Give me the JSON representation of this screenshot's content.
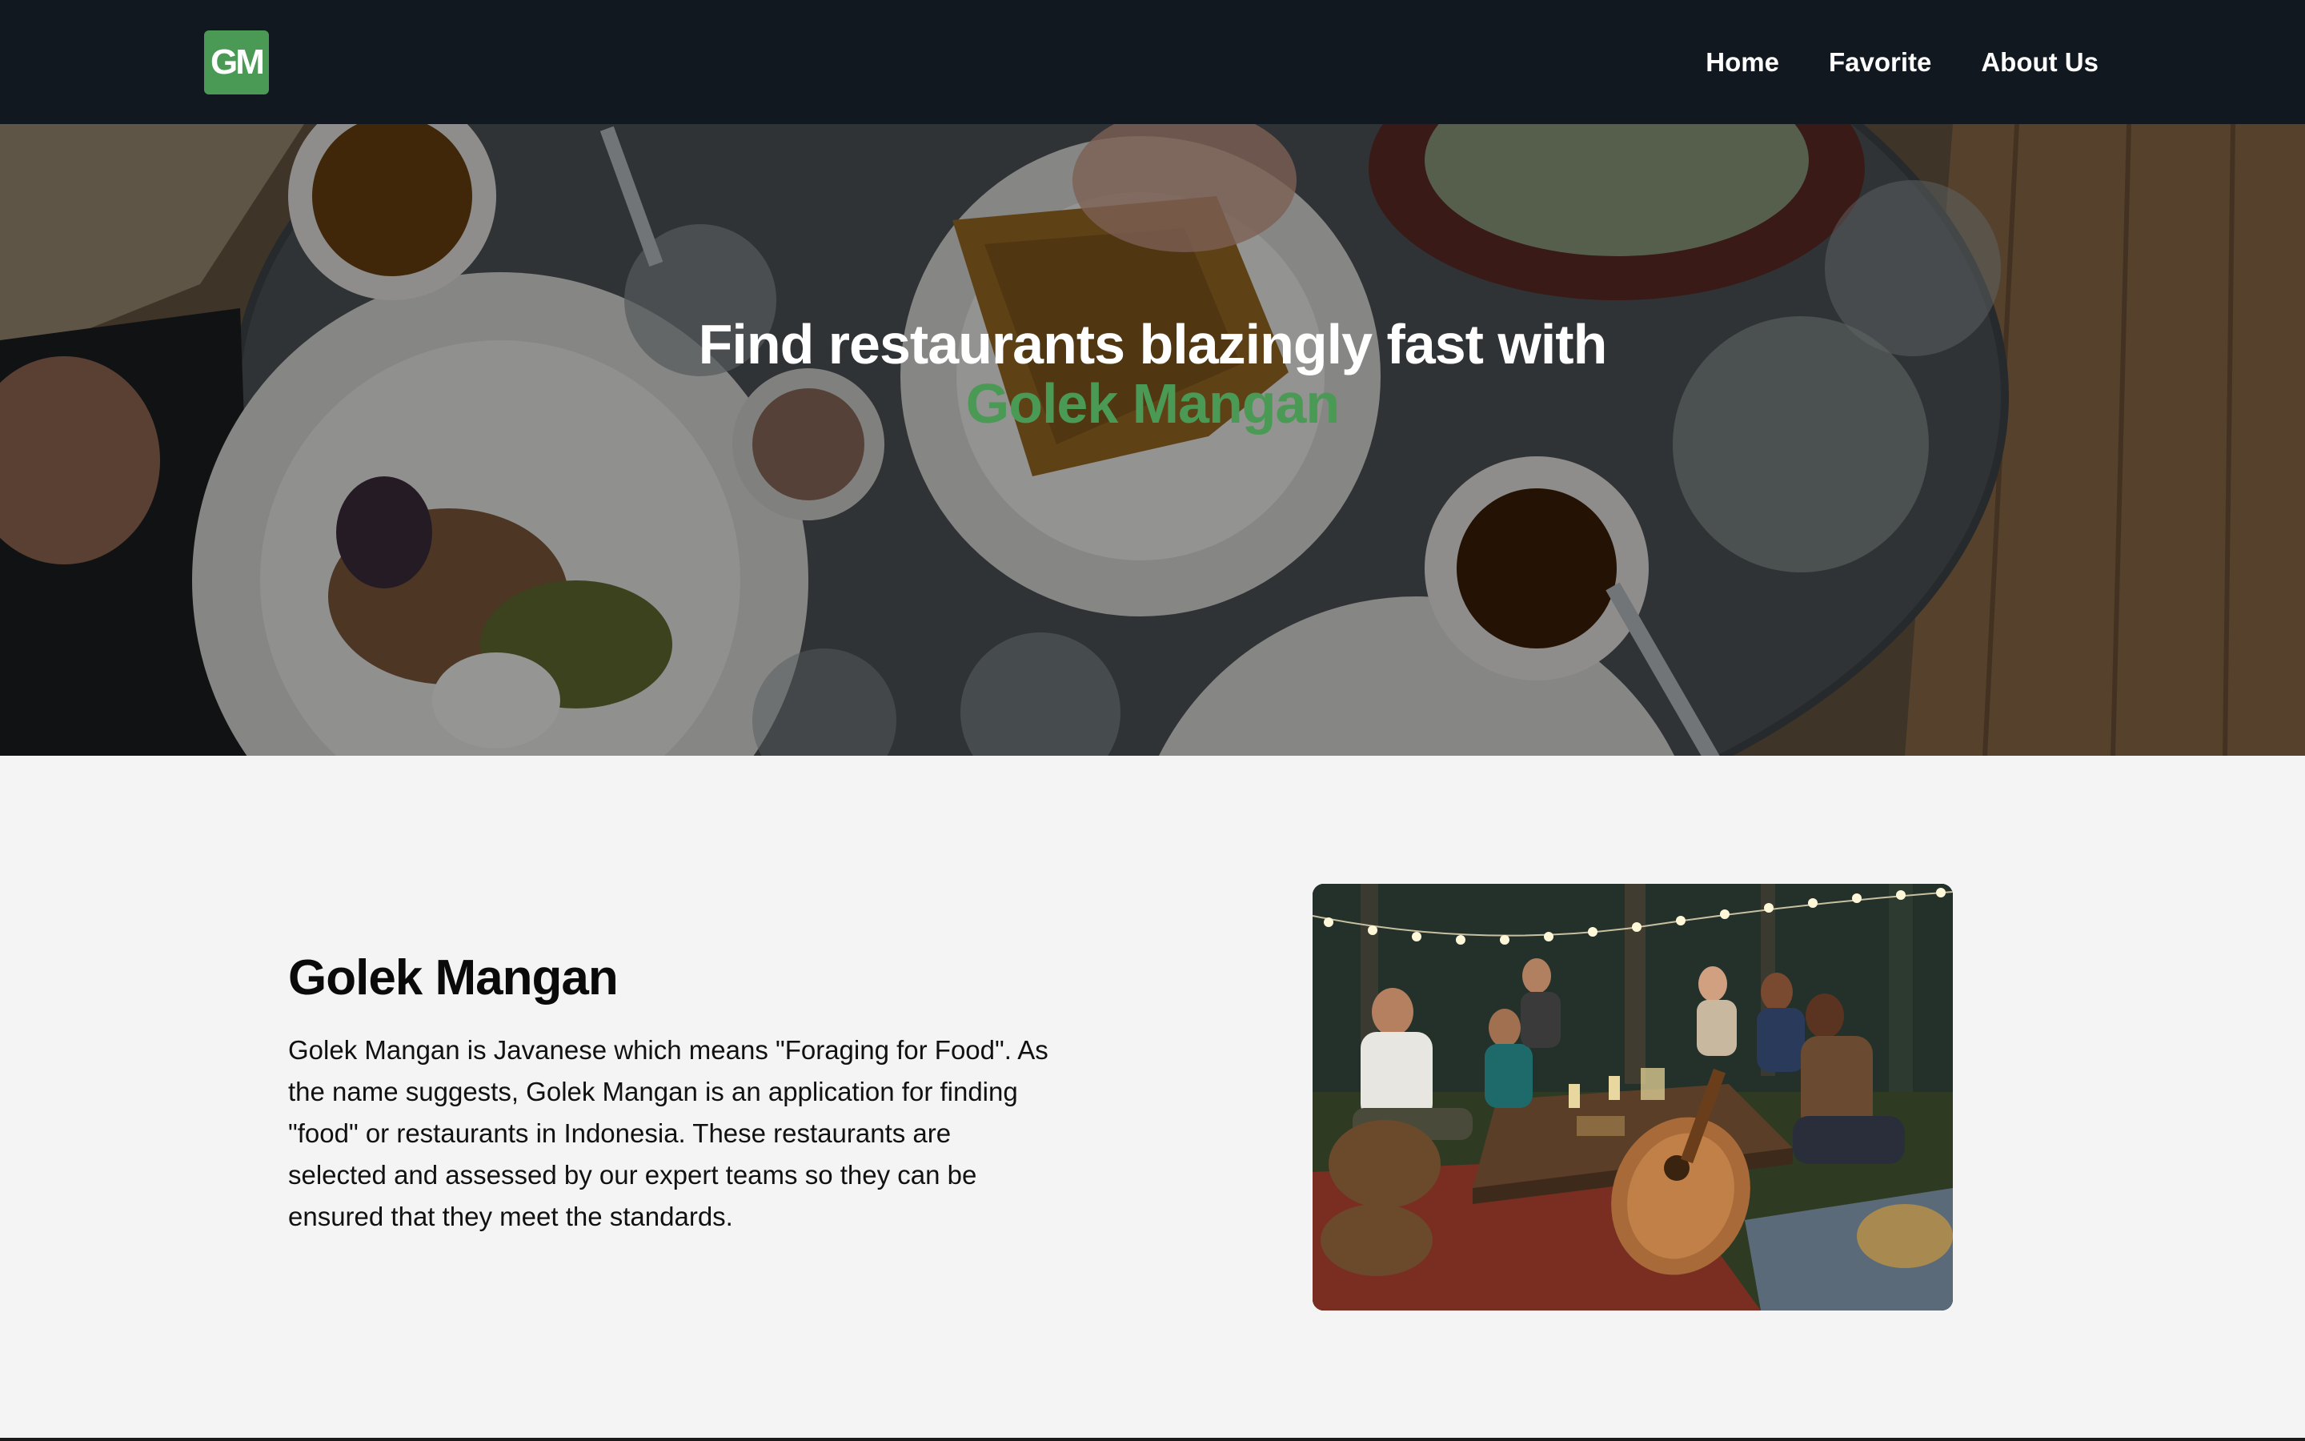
{
  "brand": {
    "logo_text": "GM",
    "accent_color": "#4a9a55",
    "navbar_color": "#111820"
  },
  "nav": {
    "items": [
      {
        "label": "Home"
      },
      {
        "label": "Favorite"
      },
      {
        "label": "About Us"
      }
    ]
  },
  "hero": {
    "headline": "Find restaurants blazingly fast with",
    "brand_name": "Golek Mangan",
    "background_image": "top-down photo of breakfast table with waffles, salad, coffee cups and plates"
  },
  "about": {
    "title": "Golek Mangan",
    "description": "Golek Mangan is Javanese which means \"Foraging for Food\". As the name suggests, Golek Mangan is an application for finding \"food\" or restaurants in Indonesia. These restaurants are selected and assessed by our expert teams so they can be ensured that they meet the standards.",
    "image": "group of friends dining outdoors at night under string lights with an oud"
  }
}
